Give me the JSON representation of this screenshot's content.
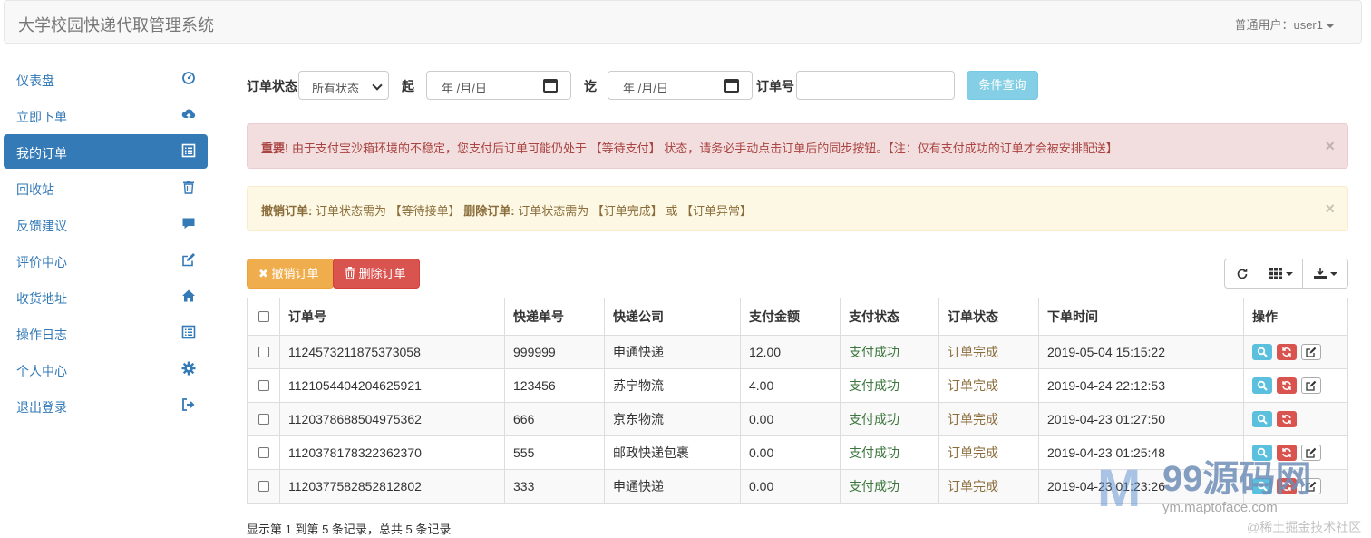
{
  "navbar": {
    "brand": "大学校园快递代取管理系统",
    "user_menu": "普通用户：user1"
  },
  "sidebar": {
    "items": [
      {
        "label": "仪表盘",
        "icon": "dashboard-icon",
        "active": false
      },
      {
        "label": "立即下单",
        "icon": "cloud-upload-icon",
        "active": false
      },
      {
        "label": "我的订单",
        "icon": "list-alt-icon",
        "active": true
      },
      {
        "label": "回收站",
        "icon": "trash-icon",
        "active": false
      },
      {
        "label": "反馈建议",
        "icon": "comment-icon",
        "active": false
      },
      {
        "label": "评价中心",
        "icon": "edit-icon",
        "active": false
      },
      {
        "label": "收货地址",
        "icon": "home-icon",
        "active": false
      },
      {
        "label": "操作日志",
        "icon": "list-alt-icon",
        "active": false
      },
      {
        "label": "个人中心",
        "icon": "cog-icon",
        "active": false
      },
      {
        "label": "退出登录",
        "icon": "log-out-icon",
        "active": false
      }
    ]
  },
  "filter": {
    "status_label": "订单状态",
    "status_value": "所有状态",
    "from_label": "起",
    "from_placeholder": "年 /月/日",
    "to_label": "讫",
    "to_placeholder": "年 /月/日",
    "order_no_label": "订单号",
    "order_no_value": "",
    "search_button": "条件查询"
  },
  "alerts": {
    "danger": {
      "strong": "重要!",
      "text": "由于支付宝沙箱环境的不稳定，您支付后订单可能仍处于 【等待支付】 状态，请务必手动点击订单后的同步按钮。【注：仅有支付成功的订单才会被安排配送】",
      "close": "×"
    },
    "warning": {
      "strong1": "撤销订单:",
      "text1": "订单状态需为 【等待接单】",
      "strong2": "删除订单:",
      "text2": "订单状态需为 【订单完成】 或 【订单异常】",
      "close": "×"
    }
  },
  "toolbar": {
    "cancel_button": "撤销订单",
    "delete_button": "删除订单"
  },
  "table": {
    "headers": [
      "订单号",
      "快递单号",
      "快递公司",
      "支付金额",
      "支付状态",
      "订单状态",
      "下单时间",
      "操作"
    ],
    "rows": [
      {
        "order_no": "1124573211875373058",
        "express_no": "999999",
        "company": "申通快递",
        "amount": "12.00",
        "pay_status": "支付成功",
        "order_status": "订单完成",
        "time": "2019-05-04 15:15:22",
        "has_edit": true
      },
      {
        "order_no": "1121054404204625921",
        "express_no": "123456",
        "company": "苏宁物流",
        "amount": "4.00",
        "pay_status": "支付成功",
        "order_status": "订单完成",
        "time": "2019-04-24 22:12:53",
        "has_edit": true
      },
      {
        "order_no": "1120378688504975362",
        "express_no": "666",
        "company": "京东物流",
        "amount": "0.00",
        "pay_status": "支付成功",
        "order_status": "订单完成",
        "time": "2019-04-23 01:27:50",
        "has_edit": false
      },
      {
        "order_no": "1120378178322362370",
        "express_no": "555",
        "company": "邮政快递包裹",
        "amount": "0.00",
        "pay_status": "支付成功",
        "order_status": "订单完成",
        "time": "2019-04-23 01:25:48",
        "has_edit": true
      },
      {
        "order_no": "1120377582852812802",
        "express_no": "333",
        "company": "申通快递",
        "amount": "0.00",
        "pay_status": "支付成功",
        "order_status": "订单完成",
        "time": "2019-04-23 01:23:26",
        "has_edit": true
      }
    ]
  },
  "pagination": {
    "info": "显示第 1 到第 5 条记录，总共 5 条记录"
  },
  "watermark": {
    "logo_text": "99源码网",
    "sub_text": "ym.maptoface.com",
    "sub_text2": "@稀土掘金技术社区"
  },
  "colors": {
    "primary": "#337ab7",
    "success_text": "#3c763d",
    "warning_text": "#8a6d3b",
    "info": "#5bc0de",
    "danger": "#d9534f",
    "warning": "#f0ad4e"
  }
}
